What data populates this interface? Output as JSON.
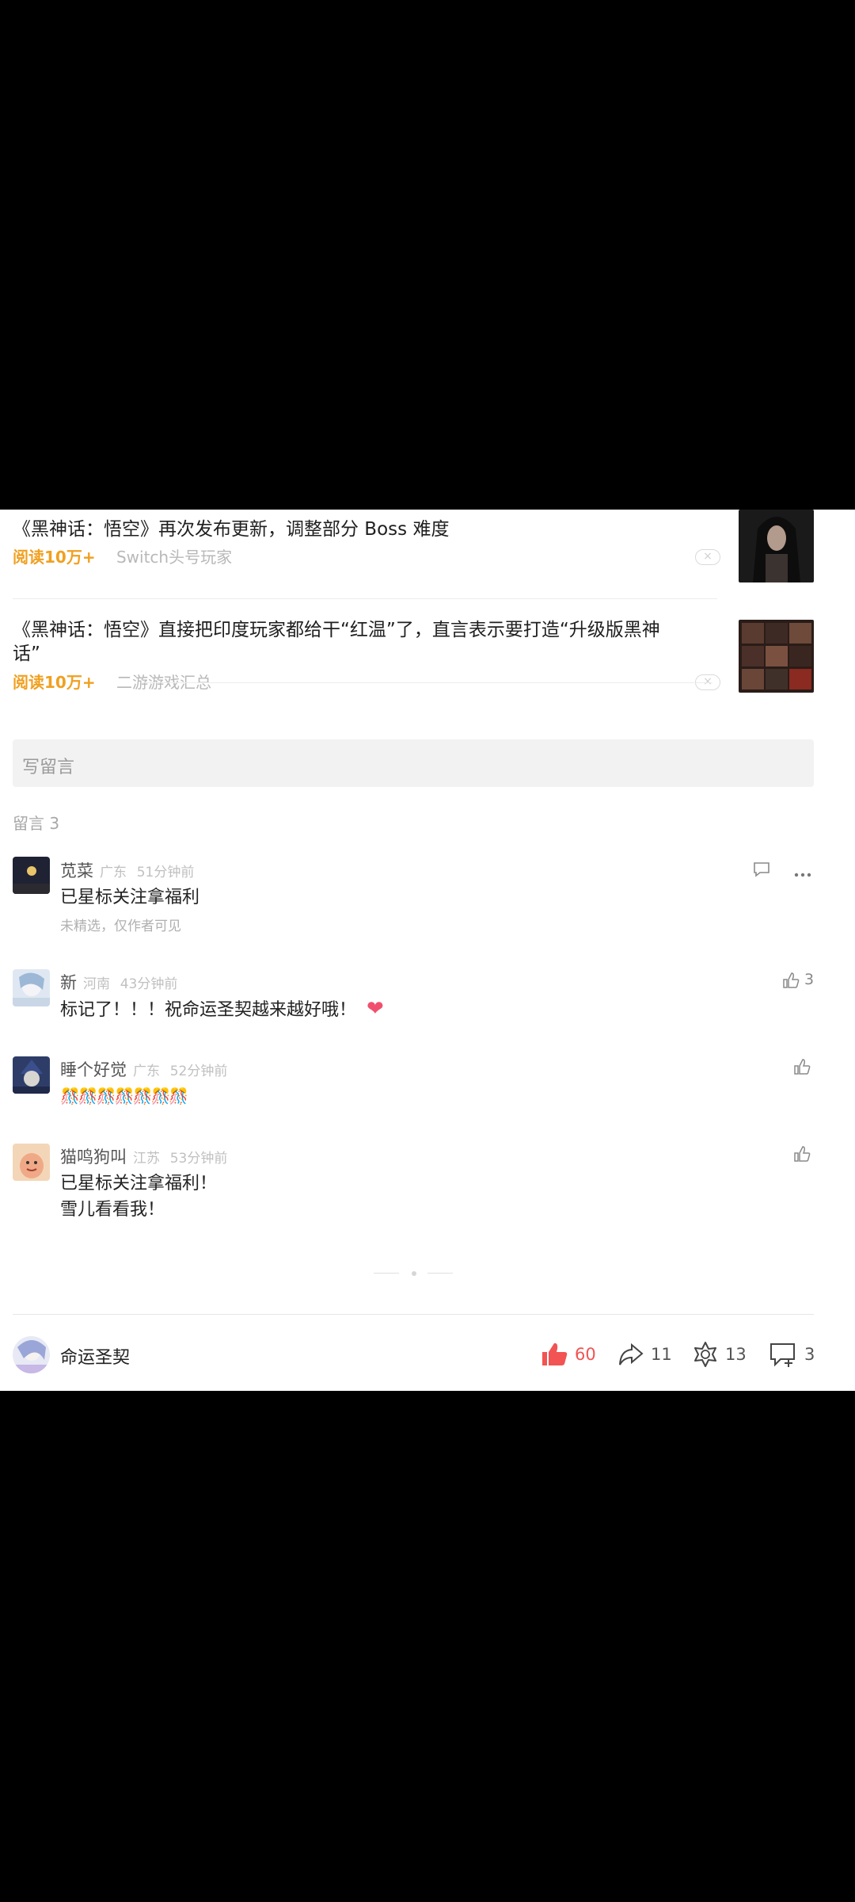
{
  "articles": [
    {
      "title": "《黑神话：悟空》再次发布更新，调整部分 Boss 难度",
      "reads": "阅读10万+",
      "source": "Switch头号玩家"
    },
    {
      "title_line1": "《黑神话：悟空》直接把印度玩家都给干“红温”了，直言表示要打造“升级版黑神",
      "title_line2": "话”",
      "reads": "阅读10万+",
      "source": "二游游戏汇总"
    }
  ],
  "comment_input": {
    "placeholder": "写留言"
  },
  "comments_label": "留言 3",
  "comments": [
    {
      "name": "苋菜",
      "place": "广东",
      "time": "51分钟前",
      "text": "已星标关注拿福利",
      "note": "未精选，仅作者可见"
    },
    {
      "name": "新",
      "place": "河南",
      "time": "43分钟前",
      "text": "标记了！！！祝命运圣契越来越好哦！",
      "emoji": "❤",
      "likes": "3"
    },
    {
      "name": "睡个好觉",
      "place": "广东",
      "time": "52分钟前",
      "text": "🎊🎊🎊🎊🎊🎊🎊"
    },
    {
      "name": "猫鸣狗叫",
      "place": "江苏",
      "time": "53分钟前",
      "text_line1": "已星标关注拿福利！",
      "text_line2": "雪儿看看我！"
    }
  ],
  "bottom_bar": {
    "account_name": "命运圣契",
    "likes": "60",
    "shares": "11",
    "wow": "13",
    "comments": "3",
    "like_color": "#f25353"
  },
  "icons": [
    "close-icon",
    "reply-icon",
    "more-icon",
    "thumb-up-icon",
    "share-icon",
    "wow-icon",
    "comment-icon"
  ]
}
